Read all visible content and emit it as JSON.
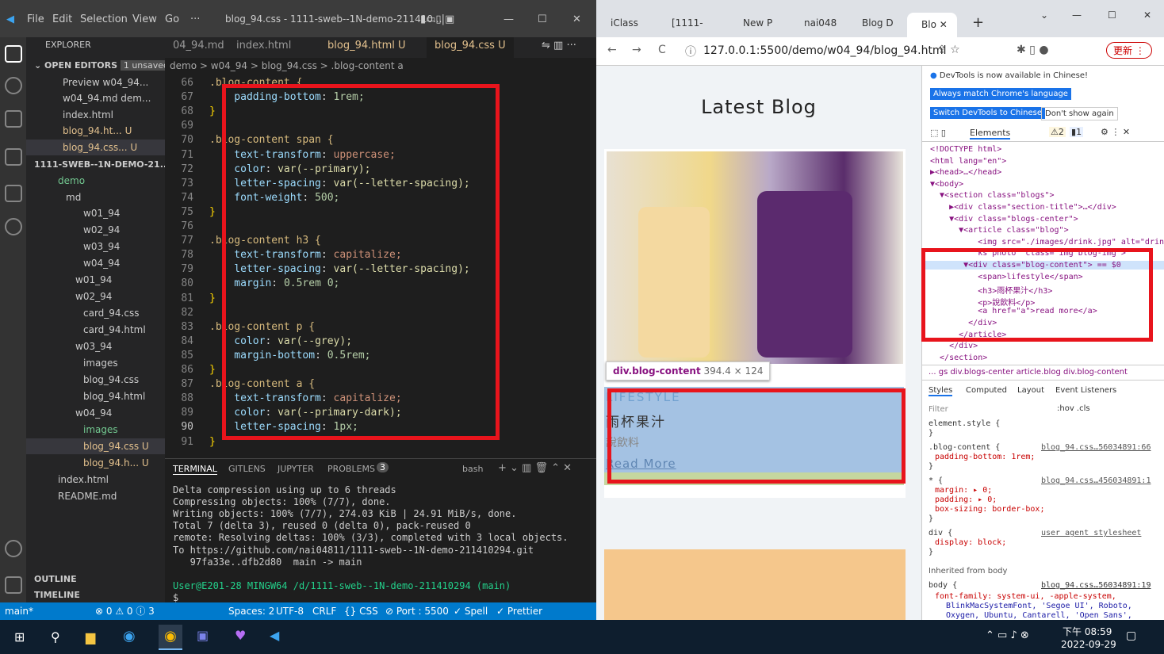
{
  "vscode": {
    "title": "blog_94.css - 1111-sweb--1N-demo-211410...",
    "menu": [
      "File",
      "Edit",
      "Selection",
      "View",
      "Go",
      "···"
    ],
    "explorer_label": "EXPLORER",
    "open_editors": "OPEN EDITORS",
    "unsaved_badge": "1 unsaved",
    "open_items": [
      "Preview w04_94...",
      "w04_94.md dem...",
      "index.html",
      "blog_94.ht...   U",
      "blog_94.css...  U"
    ],
    "tree": [
      "1111-SWEB--1N-DEMO-21...",
      "demo",
      "md",
      "w01_94",
      "w02_94",
      "w03_94",
      "w04_94",
      "w01_94",
      "w02_94",
      "card_94.css",
      "card_94.html",
      "w03_94",
      "images",
      "blog_94.css",
      "blog_94.html",
      "w04_94",
      "images",
      "blog_94.css  U",
      "blog_94.h...  U",
      "index.html",
      "README.md"
    ],
    "outline": "OUTLINE",
    "timeline": "TIMELINE",
    "tabs": [
      "04_94.md",
      "index.html",
      "blog_94.html U",
      "blog_94.css U"
    ],
    "breadcrumb": "demo > w04_94 > blog_94.css > .blog-content a",
    "line_numbers": [
      "66",
      "67",
      "68",
      "69",
      "70",
      "71",
      "72",
      "73",
      "74",
      "75",
      "76",
      "77",
      "78",
      "79",
      "80",
      "81",
      "82",
      "83",
      "84",
      "85",
      "86",
      "87",
      "88",
      "89",
      "90",
      "91"
    ],
    "code": [
      {
        "sel": ".blog-content {",
        "p": "",
        "v": ""
      },
      {
        "sel": "",
        "p": "    padding-bottom",
        "v": "1rem;"
      },
      {
        "sel": "}",
        "p": "",
        "v": ""
      },
      {
        "sel": "",
        "p": "",
        "v": ""
      },
      {
        "sel": ".blog-content span {",
        "p": "",
        "v": ""
      },
      {
        "sel": "",
        "p": "    text-transform",
        "v": "uppercase;"
      },
      {
        "sel": "",
        "p": "    color",
        "v": "var(--primary);"
      },
      {
        "sel": "",
        "p": "    letter-spacing",
        "v": "var(--letter-spacing);"
      },
      {
        "sel": "",
        "p": "    font-weight",
        "v": "500;"
      },
      {
        "sel": "}",
        "p": "",
        "v": ""
      },
      {
        "sel": "",
        "p": "",
        "v": ""
      },
      {
        "sel": ".blog-content h3 {",
        "p": "",
        "v": ""
      },
      {
        "sel": "",
        "p": "    text-transform",
        "v": "capitalize;"
      },
      {
        "sel": "",
        "p": "    letter-spacing",
        "v": "var(--letter-spacing);"
      },
      {
        "sel": "",
        "p": "    margin",
        "v": "0.5rem 0;"
      },
      {
        "sel": "}",
        "p": "",
        "v": ""
      },
      {
        "sel": "",
        "p": "",
        "v": ""
      },
      {
        "sel": ".blog-content p {",
        "p": "",
        "v": ""
      },
      {
        "sel": "",
        "p": "    color",
        "v": "var(--grey);"
      },
      {
        "sel": "",
        "p": "    margin-bottom",
        "v": "0.5rem;"
      },
      {
        "sel": "}",
        "p": "",
        "v": ""
      },
      {
        "sel": ".blog-content a {",
        "p": "",
        "v": ""
      },
      {
        "sel": "",
        "p": "    text-transform",
        "v": "capitalize;"
      },
      {
        "sel": "",
        "p": "    color",
        "v": "var(--primary-dark);"
      },
      {
        "sel": "",
        "p": "    letter-spacing",
        "v": "1px;"
      },
      {
        "sel": "}",
        "p": "",
        "v": ""
      }
    ],
    "term_tabs": [
      "TERMINAL",
      "GITLENS",
      "JUPYTER",
      "PROBLEMS",
      "bash"
    ],
    "problems_count": "3",
    "terminal": [
      "Delta compression using up to 6 threads",
      "Compressing objects: 100% (7/7), done.",
      "Writing objects: 100% (7/7), 274.03 KiB | 24.91 MiB/s, done.",
      "Total 7 (delta 3), reused 0 (delta 0), pack-reused 0",
      "remote: Resolving deltas: 100% (3/3), completed with 3 local objects.",
      "To https://github.com/nai04811/1111-sweb--1N-demo-211410294.git",
      "   97fa33e..dfb2d80  main -> main",
      "",
      "User@E201-28 MINGW64 /d/1111-sweb--1N-demo-211410294 (main)",
      "$ "
    ],
    "status": {
      "branch": "main*",
      "errors": "⊗ 0 ⚠ 0 ⓘ 3",
      "spaces": "Spaces: 2",
      "enc": "UTF-8",
      "eol": "CRLF",
      "lang": "{} CSS",
      "port": "⊘ Port : 5500",
      "spell": "✓ Spell",
      "prettier": "✓ Prettier"
    }
  },
  "chrome": {
    "tabs": [
      "iClass",
      "[1111-",
      "New P",
      "nai048",
      "Blog D",
      "Blo"
    ],
    "url": "127.0.0.1:5500/demo/w04_94/blog_94.html",
    "update_btn": "更新",
    "page_title": "Latest Blog",
    "tooltip_name": "div.blog-content",
    "tooltip_size": "394.4 × 124",
    "blog_span": "LIFESTYLE",
    "blog_h3": "雨杯果汁",
    "blog_p": "說飲料",
    "blog_a": "Read More"
  },
  "devtools": {
    "notice": "DevTools is now available in Chinese!",
    "btn1": "Always match Chrome's language",
    "btn2": "Switch DevTools to Chinese",
    "btn3": "Don't show again",
    "panel_tab": "Elements",
    "warn": "2",
    "msg": "1",
    "dom": [
      "<!DOCTYPE html>",
      "<html lang=\"en\">",
      "▶<head>…</head>",
      "▼<body>",
      "  ▼<section class=\"blogs\">",
      "    ▶<div class=\"section-title\">…</div>",
      "    ▼<div class=\"blogs-center\">",
      "      ▼<article class=\"blog\">",
      "          <img src=\"./images/drink.jpg\" alt=\"drin",
      "          ks photo\" class=\"img blog-img\">",
      "       ▼<div class=\"blog-content\"> == $0",
      "          <span>lifestyle</span>",
      "          <h3>雨杯果汁</h3>",
      "          <p>說飲料</p>",
      "          <a href=\"a\">read more</a>",
      "        </div>",
      "      </article>",
      "    </div>",
      "  </section>"
    ],
    "crumbs": "... gs  div.blogs-center  article.blog  div.blog-content",
    "style_tabs": [
      "Styles",
      "Computed",
      "Layout",
      "Event Listeners"
    ],
    "filter": "Filter",
    "hov": ":hov .cls",
    "rules": [
      {
        "sel": "element.style {",
        "src": "",
        "decl": []
      },
      {
        "sel": ".blog-content {",
        "src": "blog_94.css…56034891:66",
        "decl": [
          "padding-bottom: 1rem;"
        ]
      },
      {
        "sel": "* {",
        "src": "blog_94.css…456034891:1",
        "decl": [
          "margin: ▸ 0;",
          "padding: ▸ 0;",
          "box-sizing: border-box;"
        ]
      },
      {
        "sel": "div {",
        "src": "user agent stylesheet",
        "decl": [
          "display: block;"
        ]
      }
    ],
    "inherited": "Inherited from body",
    "body_rule": "body {",
    "body_src": "blog_94.css…56034891:19",
    "body_decl": "font-family: system-ui, -apple-system,",
    "body_decl2": "BlinkMacSystemFont, 'Segoe UI', Roboto,",
    "body_decl3": "Oxygen, Ubuntu, Cantarell, 'Open Sans',"
  },
  "taskbar": {
    "time": "下午 08:59",
    "date": "2022-09-29"
  }
}
